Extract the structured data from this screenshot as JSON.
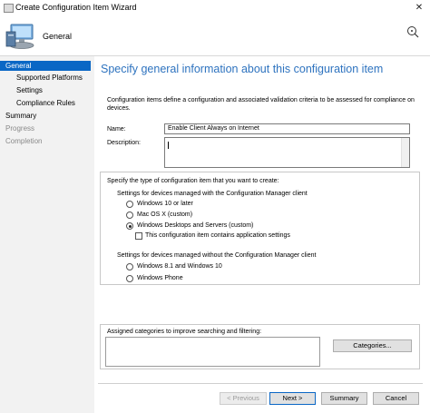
{
  "window": {
    "title": "Create Configuration Item Wizard",
    "close_glyph": "✕"
  },
  "header": {
    "title": "General"
  },
  "nav": {
    "items": [
      {
        "label": "General"
      },
      {
        "label": "Supported Platforms"
      },
      {
        "label": "Settings"
      },
      {
        "label": "Compliance Rules"
      },
      {
        "label": "Summary"
      },
      {
        "label": "Progress"
      },
      {
        "label": "Completion"
      }
    ]
  },
  "main": {
    "heading": "Specify general information about this configuration item",
    "intro": "Configuration items define a configuration and associated validation criteria to be assessed for compliance on",
    "intro2": "devices.",
    "name_label": "Name:",
    "name_value": "Enable Client Always on Internet",
    "description_label": "Description:",
    "type_label": "Specify the type of configuration item that you want to create:",
    "managed_label": "Settings for devices managed with the Configuration Manager client",
    "managed_options": [
      {
        "label": "Windows 10 or later",
        "selected": false
      },
      {
        "label": "Mac OS X (custom)",
        "selected": false
      },
      {
        "label": "Windows Desktops and Servers (custom)",
        "selected": true
      }
    ],
    "app_settings_label": "This configuration item contains application settings",
    "unmanaged_label": "Settings for devices managed without the Configuration Manager client",
    "unmanaged_options": [
      {
        "label": "Windows 8.1 and Windows 10",
        "selected": false
      },
      {
        "label": "Windows Phone",
        "selected": false
      }
    ],
    "categories_label": "Assigned categories to improve searching and filtering:",
    "categories_button": "Categories..."
  },
  "footer": {
    "previous": "< Previous",
    "next": "Next >",
    "summary": "Summary",
    "cancel": "Cancel"
  },
  "colors": {
    "accent": "#0a67c5",
    "heading": "#2e73bf",
    "nav_bg": "#f2f2f2"
  }
}
